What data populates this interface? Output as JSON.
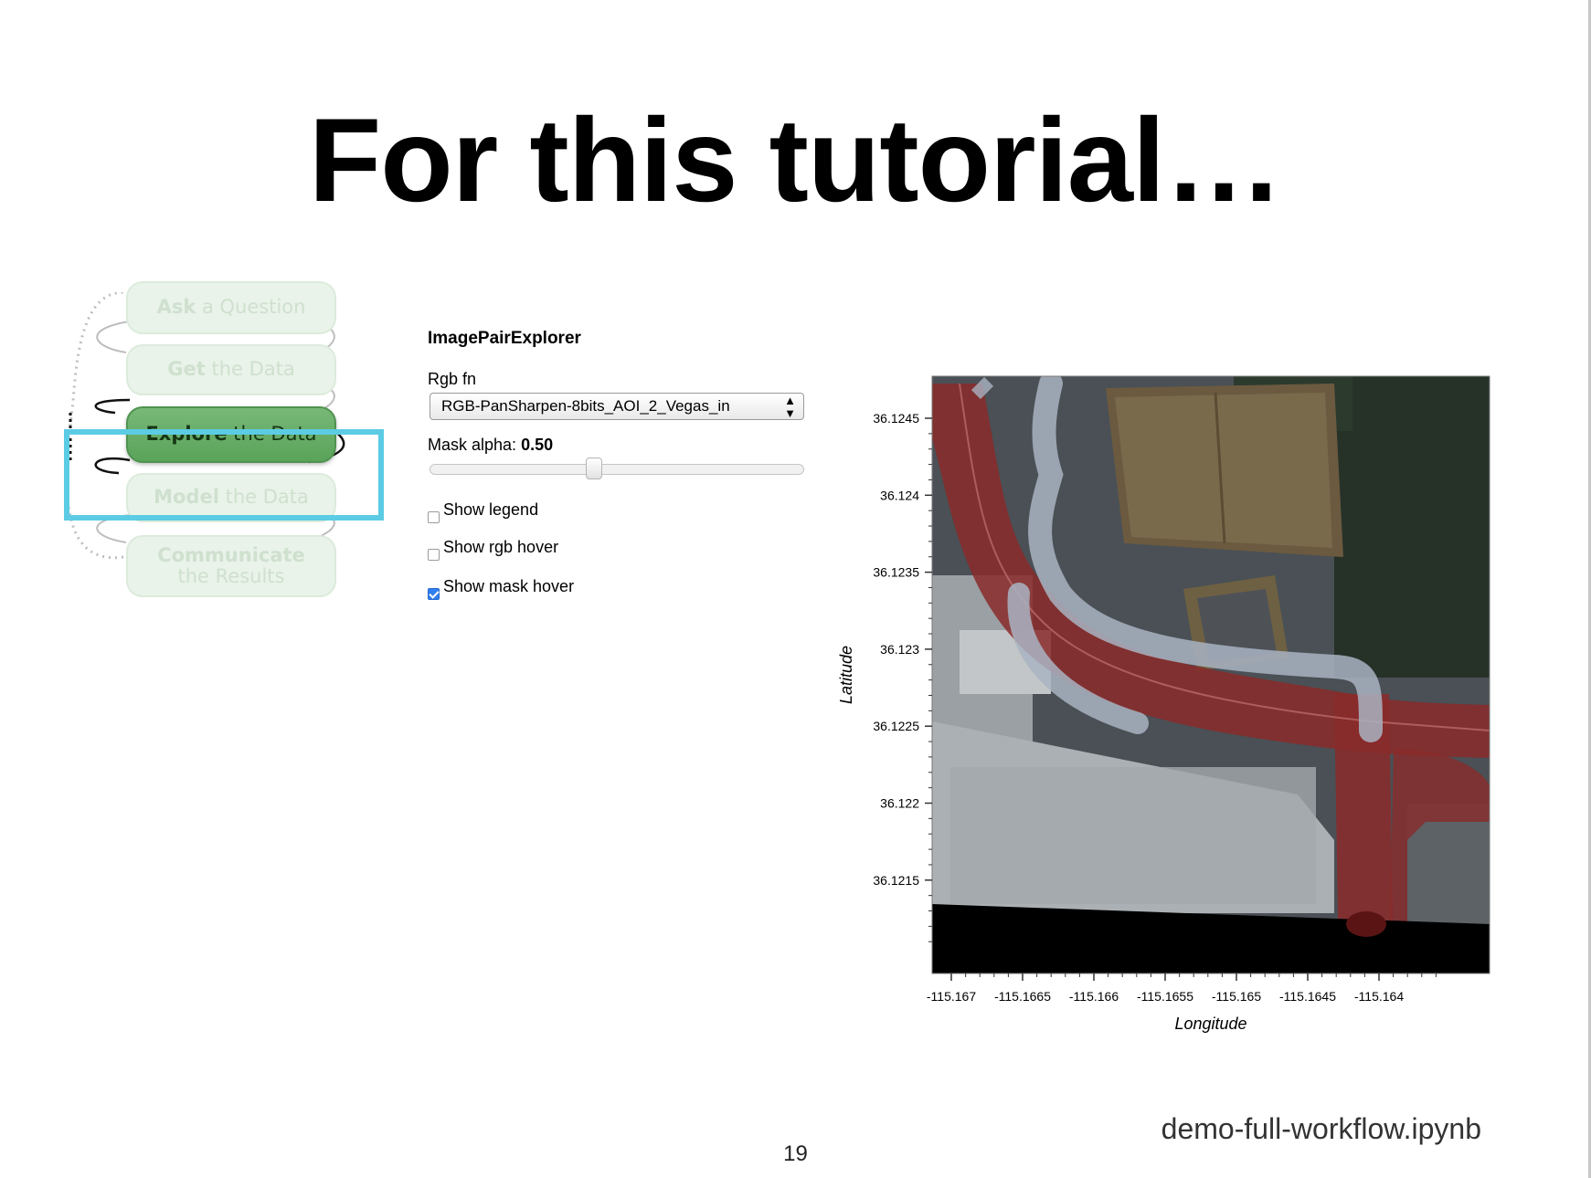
{
  "slide": {
    "title": "For this tutorial…",
    "filename": "demo-full-workflow.ipynb",
    "page_number": "19"
  },
  "workflow": {
    "steps": [
      {
        "bold": "Ask",
        "rest": " a Question",
        "active": false
      },
      {
        "bold": "Get",
        "rest": " the Data",
        "active": false
      },
      {
        "bold": "Explore",
        "rest": " the Data",
        "active": true
      },
      {
        "bold": "Model",
        "rest": " the Data",
        "active": false
      },
      {
        "bold": "Communicate",
        "rest": " the Results",
        "active": false
      }
    ],
    "highlight_color": "#5ccbe4"
  },
  "widget": {
    "title": "ImagePairExplorer",
    "rgb_label": "Rgb fn",
    "rgb_value": "RGB-PanSharpen-8bits_AOI_2_Vegas_in",
    "mask_alpha_label": "Mask alpha:",
    "mask_alpha_value": "0.50",
    "mask_alpha_fraction": 0.5,
    "checkboxes": [
      {
        "label": "Show legend",
        "checked": false
      },
      {
        "label": "Show rgb hover",
        "checked": false
      },
      {
        "label": "Show mask hover",
        "checked": true
      }
    ]
  },
  "map": {
    "ylabel": "Latitude",
    "xlabel": "Longitude",
    "y_ticks": [
      "36.1245",
      "36.124",
      "36.1235",
      "36.123",
      "36.1225",
      "36.122",
      "36.1215"
    ],
    "x_ticks": [
      "-115.167",
      "-115.1665",
      "-115.166",
      "-115.1655",
      "-115.165",
      "-115.1645",
      "-115.164"
    ],
    "mask_colors": {
      "road": "#8a2a2a",
      "path": "#a9b3c2"
    }
  }
}
